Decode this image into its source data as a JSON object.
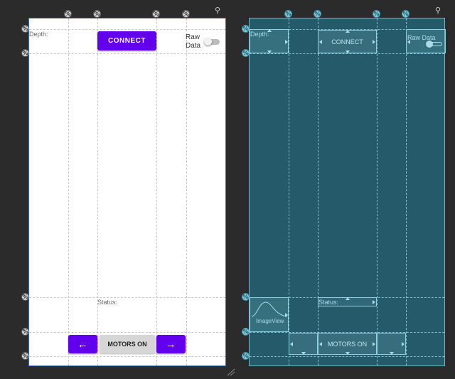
{
  "design": {
    "depth_label": "Depth:",
    "connect_label": "CONNECT",
    "raw_data_label_line1": "Raw",
    "raw_data_label_line2": "Data",
    "raw_data_toggle_on": false,
    "status_label": "Status:",
    "left_arrow": "←",
    "motors_on_label": "MOTORS ON",
    "right_arrow": "→"
  },
  "blueprint": {
    "depth_label": "Depth:",
    "connect_label": "CONNECT",
    "raw_data_label": "Raw Data",
    "status_label": "Status:",
    "imageview_label": "ImageView",
    "motors_on_label": "MOTORS ON"
  },
  "guideline_glyph": "%",
  "wrench_glyph": "⚲",
  "colors": {
    "canvas_bg": "#2b2b2b",
    "accent_purple": "#6200ee",
    "blueprint_bg": "#255a6a",
    "button_grey": "#d6d6d6"
  }
}
